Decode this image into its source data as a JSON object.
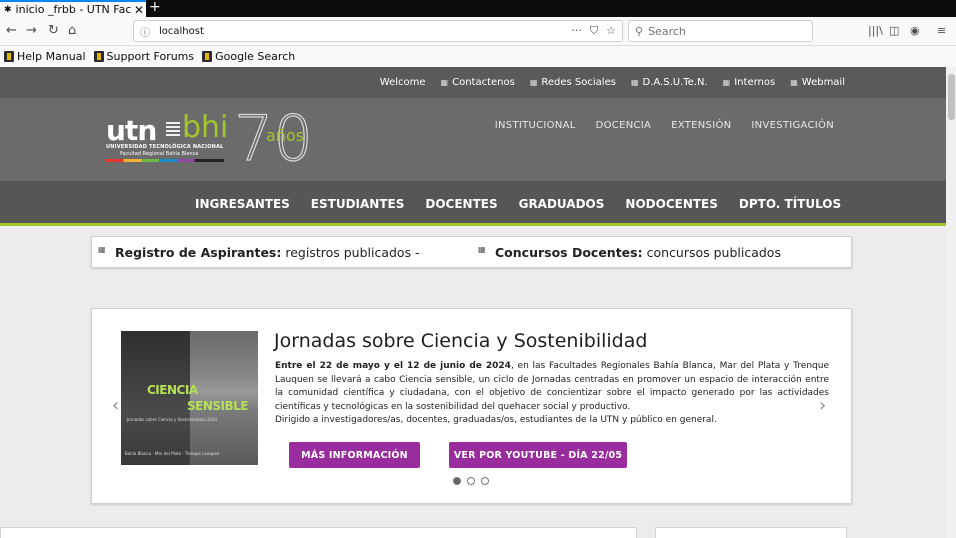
{
  "browser": {
    "tab": {
      "favicon": "sun-icon",
      "title": "inicio _frbb - UTN Facu",
      "close": "✕"
    },
    "new_tab": "+",
    "nav": {
      "back": "←",
      "forward": "→",
      "reload": "↻",
      "home": "⌂"
    },
    "url": "localhost",
    "search_placeholder": "Search",
    "bookmarks": [
      "Help Manual",
      "Support Forums",
      "Google Search"
    ]
  },
  "site": {
    "toplinks": [
      {
        "label": "Welcome",
        "icon": ""
      },
      {
        "label": "Contactenos",
        "icon": "image-icon"
      },
      {
        "label": "Redes Sociales",
        "icon": "image-icon"
      },
      {
        "label": "D.A.S.U.Te.N.",
        "icon": "image-icon"
      },
      {
        "label": "Internos",
        "icon": "image-icon"
      },
      {
        "label": "Webmail",
        "icon": "image-icon"
      }
    ],
    "logo": {
      "utn": "utn",
      "bhi": "bhi",
      "line1": "UNIVERSIDAD TECNOLÓGICA NACIONAL",
      "line2": "Facultad Regional Bahía Blanca",
      "seventy": "70",
      "anos": "años"
    },
    "main_menu": [
      "INSTITUCIONAL",
      "DOCENCIA",
      "EXTENSIÓN",
      "INVESTIGACIÓN"
    ],
    "nav_items": [
      "INGRESANTES",
      "ESTUDIANTES",
      "DOCENTES",
      "GRADUADOS",
      "NODOCENTES",
      "DPTO. TÍTULOS"
    ],
    "notices": [
      {
        "bold": "Registro de Aspirantes:",
        "text": " registros publicados -"
      },
      {
        "bold": "Concursos Docentes:",
        "text": " concursos publicados"
      }
    ],
    "slide": {
      "image_text_1": "CIENCIA",
      "image_text_2": "SENSIBLE",
      "image_text_3": "Jornadas sobre Ciencia y Sostenibilidad 2024",
      "image_text_4": "Bahía Blanca · Mar del Plata · Trenque Lauquen",
      "title": "Jornadas sobre Ciencia y Sostenibilidad",
      "body_bold": "Entre el 22 de mayo y el 12 de junio de 2024",
      "body_text": ", en las Facultades Regionales Bahía Blanca, Mar del Plata y Trenque Lauquen se llevará a cabo Ciencia sensible, un ciclo de Jornadas centradas en promover un espacio de interacción entre la comunidad científica y ciudadana, con el objetivo de concientizar sobre el impacto generado por las actividades científicas y tecnológicas en la sostenibilidad del quehacer social y productivo.",
      "body_text_2": "Dirigido a investigadores/as, docentes, graduadas/os, estudiantes de la UTN y público en general.",
      "button1": "MÁS INFORMACIÓN",
      "button2": "VER POR YOUTUBE - DÍA 22/05",
      "prev": "‹",
      "next": "›"
    }
  },
  "colors": {
    "accent_green": "#a2c62c",
    "button_purple": "#9a2d9e",
    "header_gray": "#6b6b6b"
  }
}
